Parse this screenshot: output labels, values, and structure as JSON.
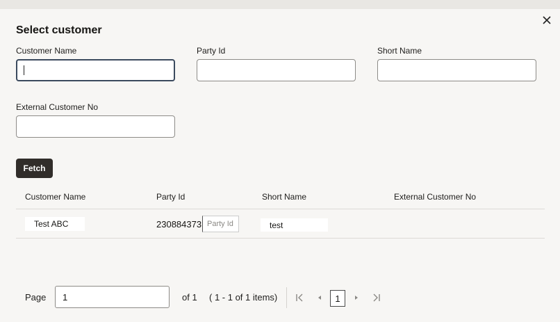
{
  "dialog": {
    "title": "Select customer",
    "close_icon": "close-icon"
  },
  "filters": {
    "customer_name": {
      "label": "Customer Name",
      "value": ""
    },
    "party_id": {
      "label": "Party Id",
      "value": ""
    },
    "short_name": {
      "label": "Short Name",
      "value": ""
    },
    "external_customer_no": {
      "label": "External Customer No",
      "value": ""
    }
  },
  "fetch_label": "Fetch",
  "table": {
    "columns": [
      "Customer Name",
      "Party Id",
      "Short Name",
      "External Customer No"
    ],
    "rows": [
      {
        "customer_name": "Test ABC",
        "party_id": "230884373",
        "party_id_placeholder": "Party Id",
        "short_name": "test",
        "external_customer_no": ""
      }
    ]
  },
  "pagination": {
    "page_label": "Page",
    "current_page": "1",
    "of_label": "of 1",
    "items_label": "( 1 - 1 of 1 items)",
    "page_number": "1",
    "icons": [
      "first-page-icon",
      "previous-page-icon",
      "next-page-icon",
      "last-page-icon"
    ]
  }
}
